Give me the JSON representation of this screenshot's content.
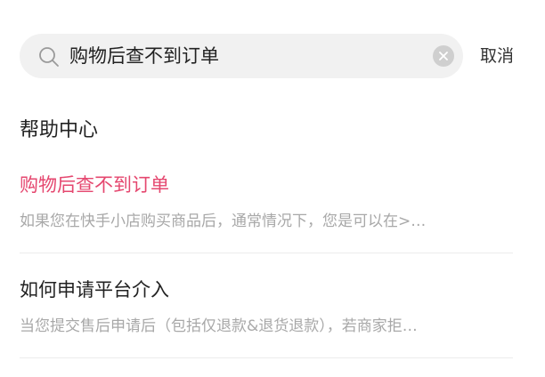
{
  "search": {
    "value": "购物后查不到订单",
    "cancel_label": "取消"
  },
  "section": {
    "title": "帮助中心"
  },
  "results": [
    {
      "title": "购物后查不到订单",
      "snippet": "如果您在快手小店购买商品后，通常情况下，您是可以在>…"
    },
    {
      "title": "如何申请平台介入",
      "snippet": "当您提交售后申请后（包括仅退款&退货退款），若商家拒…"
    }
  ],
  "colors": {
    "highlight": "#e5476f",
    "search_bg": "#f1f1f1",
    "snippet": "#a8a8a8"
  }
}
